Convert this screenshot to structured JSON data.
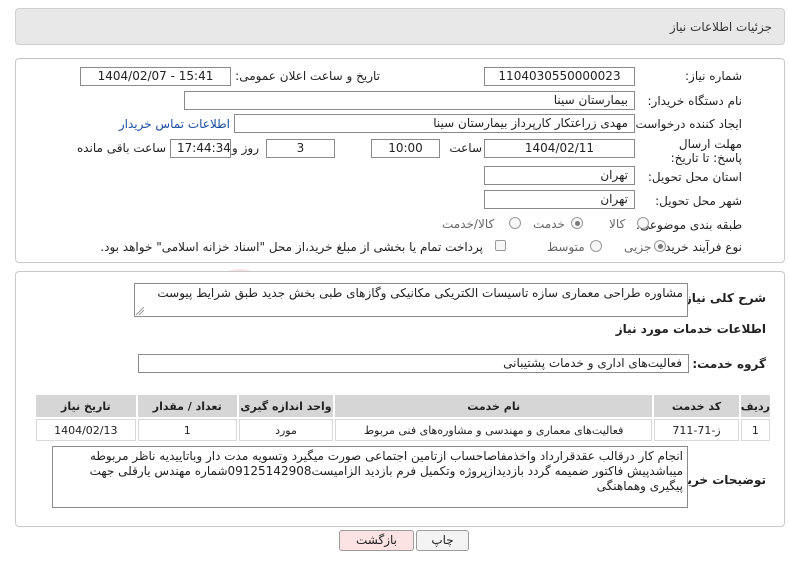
{
  "header": {
    "title": "جزئیات اطلاعات نیاز"
  },
  "form": {
    "need_number_label": "شماره نیاز:",
    "need_number": "1104030550000023",
    "announce_label": "تاریخ و ساعت اعلان عمومی:",
    "announce_value": "1404/02/07 - 15:41",
    "buyer_org_label": "نام دستگاه خریدار:",
    "buyer_org": "بیمارستان سینا",
    "requester_label": "ایجاد کننده درخواست:",
    "requester": "مهدی  زراعتکار  کارپرداز بیمارستان سینا",
    "contact_link": "اطلاعات تماس خریدار",
    "deadline_label": "مهلت ارسال پاسخ: تا تاریخ:",
    "deadline_date": "1404/02/11",
    "time_label": "ساعت",
    "deadline_time": "10:00",
    "days_value": "3",
    "day_label": "روز و",
    "remaining_time": "17:44:34",
    "remaining_label": "ساعت باقی مانده",
    "province_label": "استان محل تحویل:",
    "province": "تهران",
    "city_label": "شهر محل تحویل:",
    "city": "تهران",
    "category_label": "طبقه بندی موضوعی:",
    "category_options": [
      "کالا",
      "خدمت",
      "کالا/خدمت"
    ],
    "category_selected": "خدمت",
    "process_label": "نوع فرآیند خرید :",
    "process_options": [
      "جزیی",
      "متوسط"
    ],
    "process_selected": "جزیی",
    "payment_note": "پرداخت تمام یا بخشی از مبلغ خرید،از محل \"اسناد خزانه اسلامی\" خواهد بود."
  },
  "description": {
    "label": "شرح کلی نیاز:",
    "value": "مشاوره طراحی  معماری سازه تاسیسات الکتریکی مکانیکی وگازهای طبی بخش جدید طبق شرایط پیوست"
  },
  "services": {
    "section_title": "اطلاعات خدمات مورد نیاز",
    "group_label": "گروه خدمت:",
    "group_value": "فعالیت‌های اداری و خدمات پشتیبانی",
    "columns": [
      "ردیف",
      "کد خدمت",
      "نام خدمت",
      "واحد اندازه گیری",
      "تعداد / مقدار",
      "تاریخ نیاز"
    ],
    "rows": [
      [
        "1",
        "ز-71-711",
        "فعالیت‌های معماری و مهندسی و مشاوره‌های فنی مربوط",
        "مورد",
        "1",
        "1404/02/13"
      ]
    ]
  },
  "buyer_notes": {
    "label": "توضیحات خریدار:",
    "value": "انجام کار درقالب عقدقرارداد واخذمفاصاحساب ازتامین اجتماعی صورت میگیرد وتسویه مدت دار وباتاییدیه ناظر مربوطه میباشدپیش فاکتور ضمیمه گردد بازدیدازپروژه وتکمیل فرم بازدید الزامیست09125142908شماره مهندس یارقلی جهت پیگیری وهماهنگی"
  },
  "buttons": {
    "print": "چاپ",
    "back": "بازگشت"
  },
  "watermark": {
    "text": "AriaTender.neT"
  },
  "colors": {
    "header_bg": "#e8e8e8",
    "back_button_bg": "#fbe3e3",
    "link": "#1a4fa0",
    "watermark": "#d23a3a"
  }
}
